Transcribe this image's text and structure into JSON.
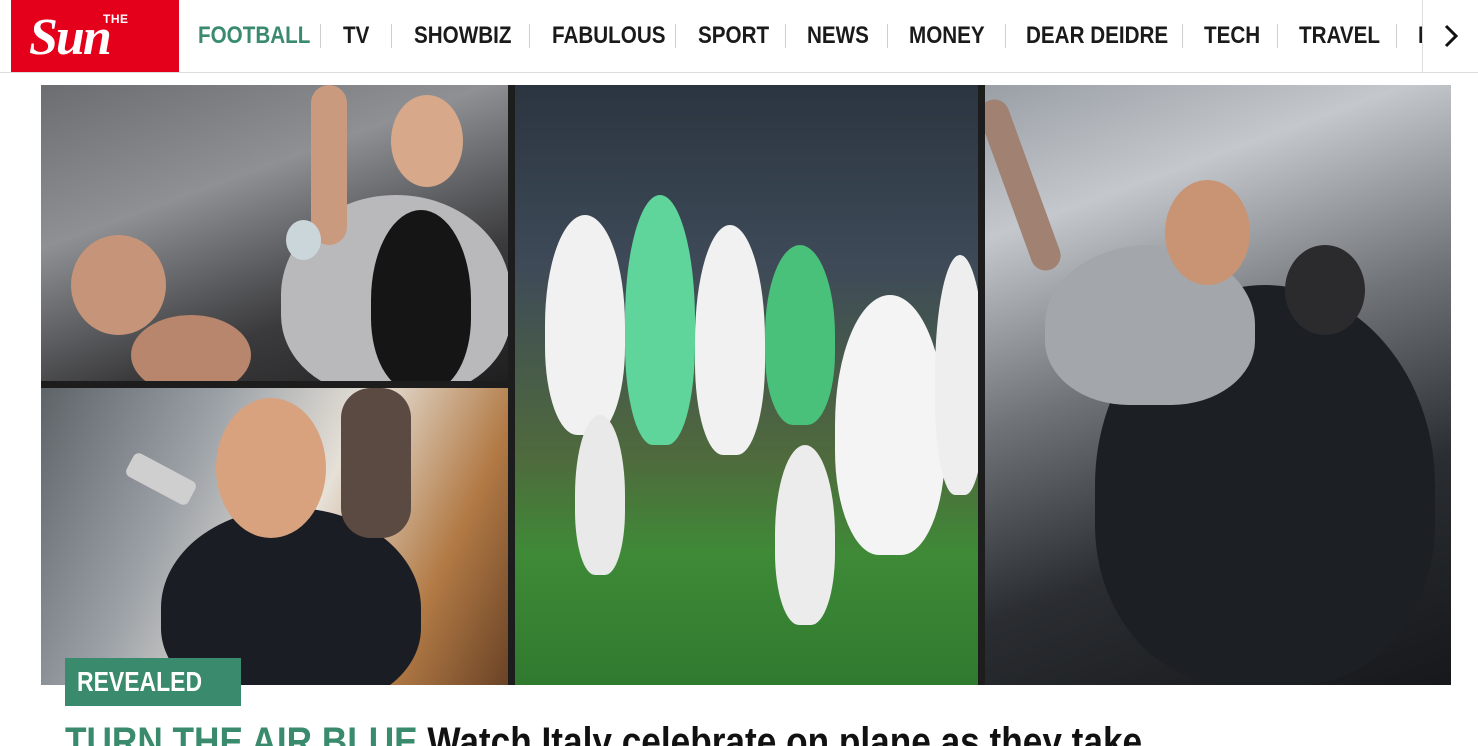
{
  "header": {
    "logo": {
      "small": "THE",
      "main": "Sun"
    },
    "nav_items": [
      {
        "label": "FOOTBALL",
        "active": true
      },
      {
        "label": "TV",
        "active": false
      },
      {
        "label": "SHOWBIZ",
        "active": false
      },
      {
        "label": "FABULOUS",
        "active": false
      },
      {
        "label": "SPORT",
        "active": false
      },
      {
        "label": "NEWS",
        "active": false
      },
      {
        "label": "MONEY",
        "active": false
      },
      {
        "label": "DEAR DEIDRE",
        "active": false
      },
      {
        "label": "TECH",
        "active": false
      },
      {
        "label": "TRAVEL",
        "active": false
      },
      {
        "label": "M",
        "active": false
      }
    ],
    "next_icon": "chevron-right-icon"
  },
  "hero": {
    "images": [
      {
        "name": "players-celebrating-on-plane-left"
      },
      {
        "name": "player-shouting-into-intercom"
      },
      {
        "name": "team-celebrating-on-pitch"
      },
      {
        "name": "player-singing-on-plane-right"
      }
    ],
    "tag": "REVEALED",
    "kicker": "TURN THE AIR BLUE",
    "title": "Watch Italy celebrate on plane as they take"
  },
  "colors": {
    "brand_red": "#e4001b",
    "accent_green": "#3a8a6e",
    "text": "#111111"
  }
}
